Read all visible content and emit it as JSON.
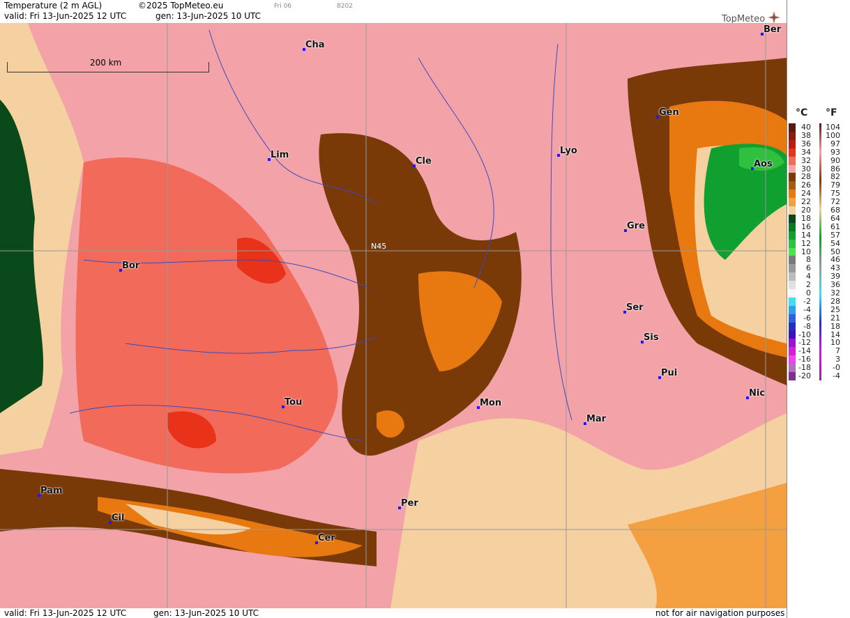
{
  "header": {
    "title": "Temperature (2 m AGL)",
    "copyright": "©2025 TopMeteo.eu",
    "run_label": "Fri 06",
    "run_code": "8202",
    "valid": "valid:  Fri  13-Jun-2025  12 UTC",
    "gen": "gen: 13-Jun-2025 10 UTC",
    "brand": "TopMeteo"
  },
  "map": {
    "scale_label": "200 km",
    "lat_label": "N45",
    "cities": [
      {
        "name": "Cha"
      },
      {
        "name": "Ber"
      },
      {
        "name": "Lim"
      },
      {
        "name": "Cle"
      },
      {
        "name": "Lyo"
      },
      {
        "name": "Gen"
      },
      {
        "name": "Aos"
      },
      {
        "name": "Gre"
      },
      {
        "name": "Bor"
      },
      {
        "name": "Ser"
      },
      {
        "name": "Sis"
      },
      {
        "name": "Pui"
      },
      {
        "name": "Tou"
      },
      {
        "name": "Mon"
      },
      {
        "name": "Nic"
      },
      {
        "name": "Mar"
      },
      {
        "name": "Pam"
      },
      {
        "name": "Cil"
      },
      {
        "name": "Per"
      },
      {
        "name": "Cer"
      }
    ]
  },
  "legend": {
    "unit_c": "°C",
    "unit_f": "°F",
    "celsius": [
      "40",
      "38",
      "36",
      "34",
      "32",
      "30",
      "28",
      "26",
      "24",
      "22",
      "20",
      "18",
      "16",
      "14",
      "12",
      "10",
      "8",
      "6",
      "4",
      "2",
      "0",
      "-2",
      "-4",
      "-6",
      "-8",
      "-10",
      "-12",
      "-14",
      "-16",
      "-18",
      "-20"
    ],
    "fahrenheit": [
      "104",
      "100",
      "97",
      "93",
      "90",
      "86",
      "82",
      "79",
      "75",
      "72",
      "68",
      "64",
      "61",
      "57",
      "54",
      "50",
      "46",
      "43",
      "39",
      "36",
      "32",
      "28",
      "25",
      "21",
      "18",
      "14",
      "10",
      "7",
      "3",
      "-0",
      "-4"
    ],
    "colors": [
      "#5a1a10",
      "#8c1a10",
      "#c01a10",
      "#e8321a",
      "#f26a5a",
      "#f3a3a8",
      "#7a3a08",
      "#a85a10",
      "#e87810",
      "#f5a040",
      "#f5d0a0",
      "#0a4a1a",
      "#0a7a20",
      "#10a030",
      "#30c040",
      "#50e050",
      "#7a7a7a",
      "#9a9a9a",
      "#bcbcbc",
      "#e0e0e0",
      "#f8f8f8",
      "#40e0f0",
      "#30a0e8",
      "#3060e0",
      "#2030c0",
      "#4010c0",
      "#a010d0",
      "#d020d0",
      "#f040f0",
      "#b070c0",
      "#803090"
    ]
  },
  "footer": {
    "valid": "valid:  Fri  13-Jun-2025  12 UTC",
    "gen": "gen: 13-Jun-2025 10 UTC",
    "note": "not for air navigation purposes"
  }
}
